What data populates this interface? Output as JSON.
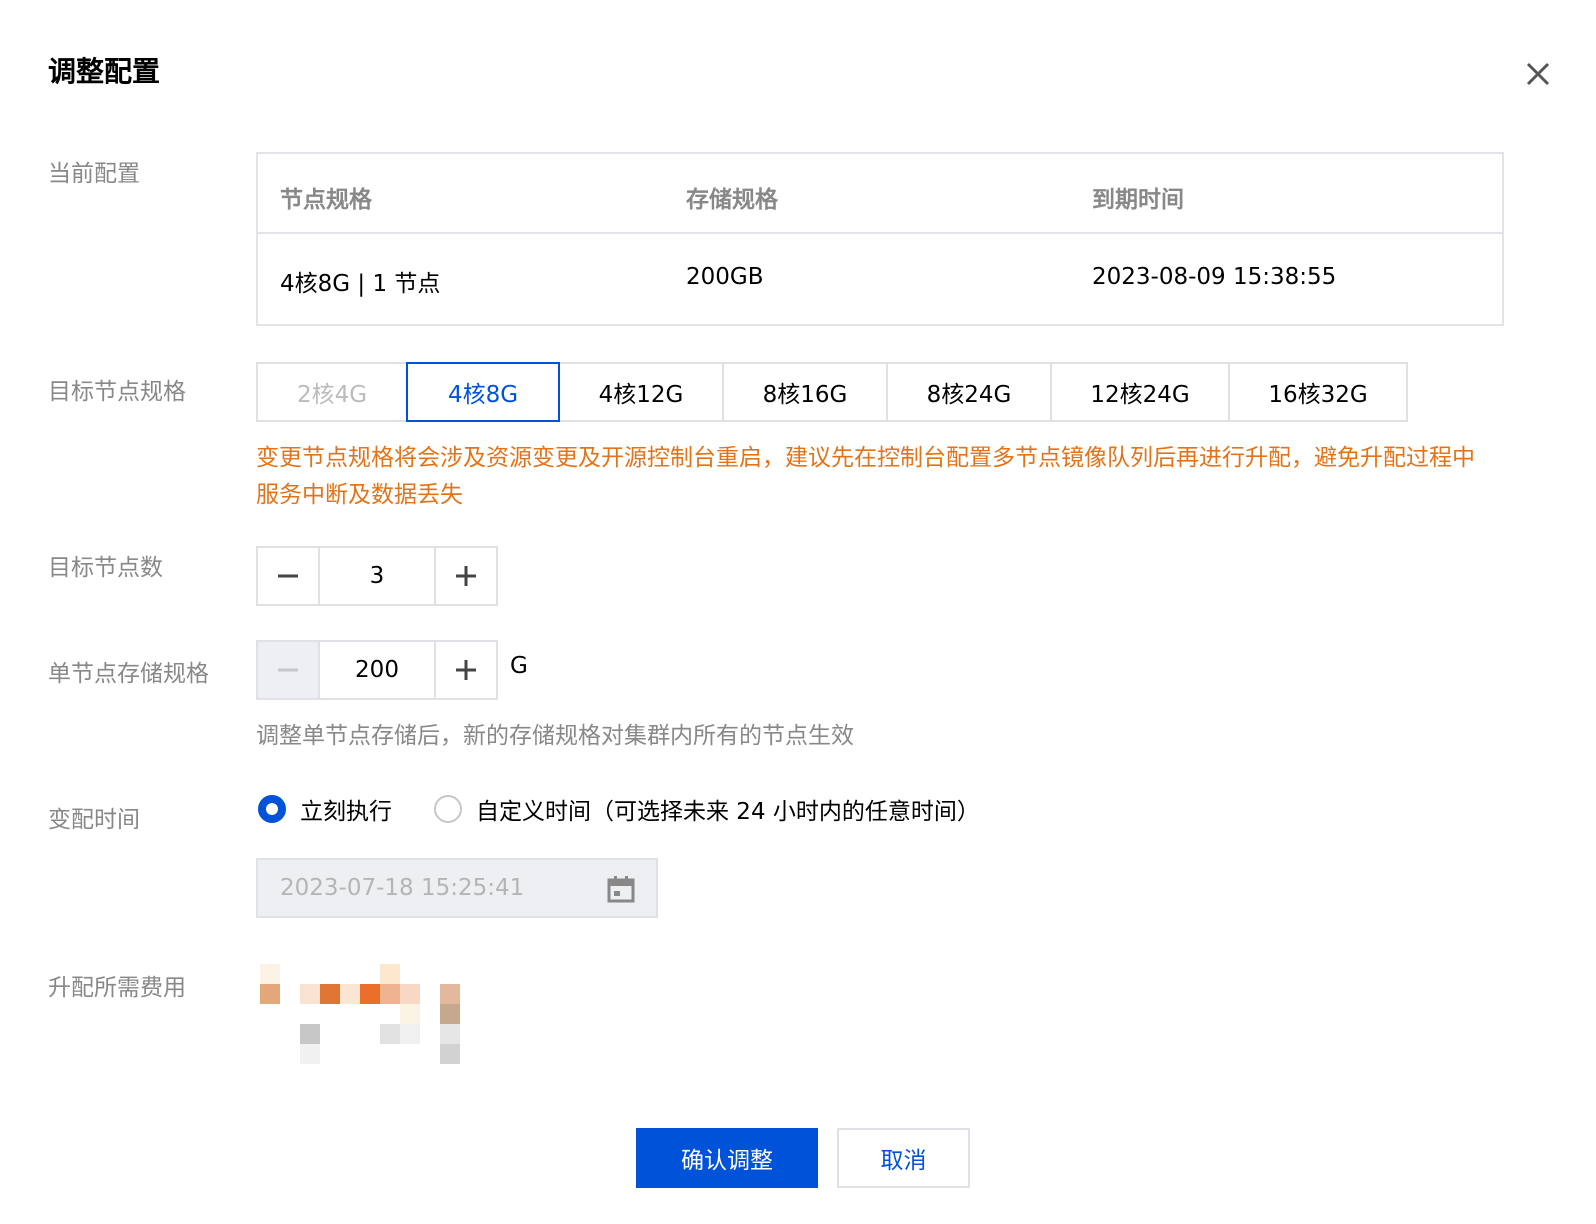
{
  "dialog": {
    "title": "调整配置"
  },
  "labels": {
    "current_config": "当前配置",
    "target_spec": "目标节点规格",
    "target_nodes": "目标节点数",
    "storage_spec": "单节点存储规格",
    "change_time": "变配时间",
    "upgrade_cost": "升配所需费用"
  },
  "current_config": {
    "headers": [
      "节点规格",
      "存储规格",
      "到期时间"
    ],
    "values": [
      "4核8G | 1 节点",
      "200GB",
      "2023-08-09 15:38:55"
    ]
  },
  "spec_options": [
    {
      "label": "2核4G",
      "state": "disabled"
    },
    {
      "label": "4核8G",
      "state": "selected"
    },
    {
      "label": "4核12G",
      "state": "normal"
    },
    {
      "label": "8核16G",
      "state": "normal"
    },
    {
      "label": "8核24G",
      "state": "normal"
    },
    {
      "label": "12核24G",
      "state": "normal"
    },
    {
      "label": "16核32G",
      "state": "normal"
    }
  ],
  "warning": "变更节点规格将会涉及资源变更及开源控制台重启，建议先在控制台配置多节点镜像队列后再进行升配，避免升配过程中服务中断及数据丢失",
  "node_count": {
    "value": "3"
  },
  "storage": {
    "value": "200",
    "unit": "G",
    "hint": "调整单节点存储后，新的存储规格对集群内所有的节点生效"
  },
  "change_time": {
    "options": [
      {
        "label": "立刻执行",
        "checked": true
      },
      {
        "label": "自定义时间（可选择未来 24 小时内的任意时间）",
        "checked": false
      }
    ],
    "datetime": "2023-07-18 15:25:41"
  },
  "actions": {
    "confirm": "确认调整",
    "cancel": "取消"
  },
  "colors": {
    "primary": "#0052d9",
    "warning": "#e37318",
    "label": "#888888",
    "border": "#dfe1e6"
  },
  "icons": {
    "close": "close-icon",
    "minus": "minus-icon",
    "plus": "plus-icon",
    "calendar": "calendar-icon"
  }
}
